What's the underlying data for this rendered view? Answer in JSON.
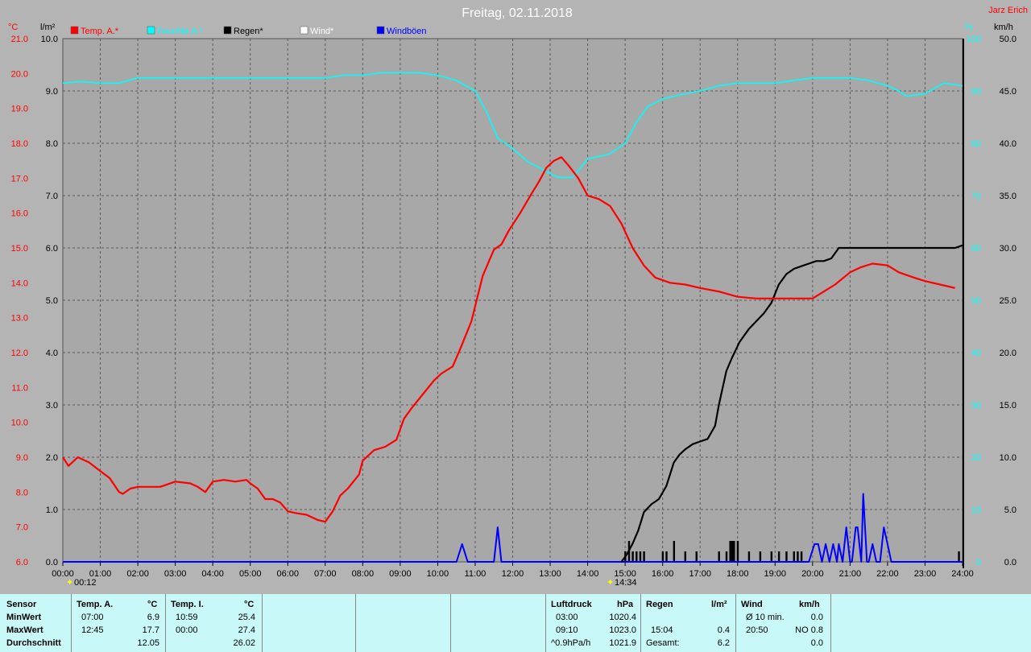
{
  "title": "Freitag, 02.11.2018",
  "author": "Jarz Erich",
  "units": {
    "temp": "°C",
    "rain": "l/m²",
    "hum": "%",
    "wind": "km/h"
  },
  "legend": [
    {
      "label": "Temp. A.*",
      "color": "#ff0000"
    },
    {
      "label": "Feuchte A.*",
      "color": "#00ffff"
    },
    {
      "label": "Regen*",
      "color": "#000000"
    },
    {
      "label": "Wind*",
      "color": "#ffffff"
    },
    {
      "label": "Windböen",
      "color": "#0000ff"
    }
  ],
  "markers": {
    "sunrise": "00:12",
    "sunset": "14:34"
  },
  "chart_data": {
    "type": "line",
    "x_unit": "hour",
    "xlim": [
      0,
      24
    ],
    "x_ticks": [
      "00:00",
      "01:00",
      "02:00",
      "03:00",
      "04:00",
      "05:00",
      "06:00",
      "07:00",
      "08:00",
      "09:00",
      "10:00",
      "11:00",
      "12:00",
      "13:00",
      "14:00",
      "15:00",
      "16:00",
      "17:00",
      "18:00",
      "19:00",
      "20:00",
      "21:00",
      "22:00",
      "23:00",
      "24:00"
    ],
    "axes": {
      "temp": {
        "label": "°C",
        "range": [
          6,
          21
        ],
        "ticks": [
          "6.0",
          "7.0",
          "8.0",
          "9.0",
          "10.0",
          "11.0",
          "12.0",
          "13.0",
          "14.0",
          "15.0",
          "16.0",
          "17.0",
          "18.0",
          "19.0",
          "20.0",
          "21.0"
        ]
      },
      "rain": {
        "label": "l/m²",
        "range": [
          0,
          10
        ],
        "ticks": [
          "0.0",
          "1.0",
          "2.0",
          "3.0",
          "4.0",
          "5.0",
          "6.0",
          "7.0",
          "8.0",
          "9.0",
          "10.0"
        ]
      },
      "hum": {
        "label": "%",
        "range": [
          0,
          100
        ],
        "ticks": [
          "0",
          "10",
          "20",
          "30",
          "40",
          "50",
          "60",
          "70",
          "80",
          "90",
          "100"
        ]
      },
      "wind": {
        "label": "km/h",
        "range": [
          0,
          50
        ],
        "ticks": [
          "0.0",
          "5.0",
          "10.0",
          "15.0",
          "20.0",
          "25.0",
          "30.0",
          "35.0",
          "40.0",
          "45.0",
          "50.0"
        ]
      }
    },
    "grid": true,
    "series": [
      {
        "name": "Temp. A.*",
        "color": "#ff0000",
        "axis": "temp",
        "x": [
          0,
          0.15,
          0.4,
          0.7,
          1,
          1.25,
          1.5,
          1.6,
          1.8,
          2,
          2.3,
          2.6,
          3,
          3.4,
          3.6,
          3.8,
          4,
          4.3,
          4.6,
          4.9,
          5,
          5.2,
          5.4,
          5.6,
          5.8,
          6,
          6.2,
          6.5,
          6.8,
          7,
          7.2,
          7.4,
          7.6,
          7.9,
          8,
          8.3,
          8.6,
          8.9,
          9.1,
          9.3,
          9.6,
          9.9,
          10.1,
          10.4,
          10.6,
          10.9,
          11.2,
          11.5,
          11.7,
          11.9,
          12.2,
          12.5,
          12.7,
          12.9,
          13.1,
          13.3,
          13.5,
          13.75,
          14,
          14.3,
          14.6,
          14.9,
          15.2,
          15.5,
          15.8,
          16.2,
          16.6,
          17,
          17.5,
          18,
          18.5,
          19,
          19.5,
          20,
          20.3,
          20.6,
          21,
          21.3,
          21.6,
          22,
          22.3,
          22.7,
          23,
          23.4,
          23.8
        ],
        "y": [
          9.0,
          8.75,
          9.0,
          8.85,
          8.6,
          8.4,
          8.0,
          7.95,
          8.1,
          8.15,
          8.15,
          8.15,
          8.3,
          8.25,
          8.15,
          8.0,
          8.3,
          8.35,
          8.3,
          8.35,
          8.25,
          8.1,
          7.8,
          7.8,
          7.7,
          7.45,
          7.4,
          7.35,
          7.2,
          7.15,
          7.45,
          7.9,
          8.1,
          8.5,
          8.9,
          9.2,
          9.3,
          9.5,
          10.1,
          10.4,
          10.8,
          11.2,
          11.4,
          11.6,
          12.1,
          12.9,
          14.2,
          14.95,
          15.1,
          15.5,
          16.0,
          16.55,
          16.9,
          17.3,
          17.5,
          17.6,
          17.35,
          17.0,
          16.5,
          16.4,
          16.2,
          15.7,
          15.0,
          14.5,
          14.15,
          14.0,
          13.95,
          13.85,
          13.75,
          13.6,
          13.55,
          13.55,
          13.55,
          13.55,
          13.75,
          13.95,
          14.3,
          14.45,
          14.55,
          14.5,
          14.3,
          14.15,
          14.05,
          13.95,
          13.85
        ]
      },
      {
        "name": "Feuchte A.*",
        "color": "#00ffff",
        "axis": "hum",
        "x": [
          0,
          0.5,
          1,
          1.5,
          2,
          3,
          4,
          5,
          6,
          7,
          7.5,
          8,
          8.5,
          9,
          9.5,
          10,
          10.5,
          11,
          11.3,
          11.6,
          12,
          12.4,
          12.8,
          13.2,
          13.6,
          14,
          14.3,
          14.6,
          15,
          15.3,
          15.6,
          16,
          16.5,
          17,
          17.5,
          18,
          18.5,
          19,
          20,
          21,
          21.5,
          22,
          22.3,
          22.5,
          23,
          23.5,
          24
        ],
        "y": [
          91.5,
          91.8,
          91.5,
          91.5,
          92.5,
          92.5,
          92.5,
          92.5,
          92.5,
          92.5,
          93,
          93,
          93.5,
          93.5,
          93.5,
          93,
          92,
          90,
          86,
          81,
          79,
          76.5,
          75,
          73.5,
          73.5,
          77,
          77.5,
          78,
          80,
          84,
          87,
          88.5,
          89.3,
          90,
          91,
          91.5,
          91.5,
          91.5,
          92.5,
          92.5,
          92,
          91,
          90,
          89,
          89.5,
          91.5,
          91
        ]
      },
      {
        "name": "Regen*",
        "color": "#000000",
        "axis": "rain",
        "x": [
          14.9,
          15.05,
          15.2,
          15.35,
          15.5,
          15.7,
          15.9,
          16.1,
          16.3,
          16.45,
          16.6,
          16.8,
          17,
          17.2,
          17.4,
          17.5,
          17.7,
          17.85,
          17.95,
          18.05,
          18.15,
          18.3,
          18.5,
          18.7,
          18.9,
          19.1,
          19.3,
          19.5,
          19.7,
          19.9,
          20.1,
          20.3,
          20.5,
          20.7,
          20.85,
          21,
          21.2,
          21.5,
          21.8,
          22.2,
          22.6,
          23,
          23.4,
          23.8,
          24
        ],
        "y": [
          0.0,
          0.15,
          0.35,
          0.6,
          0.95,
          1.1,
          1.2,
          1.45,
          1.9,
          2.05,
          2.15,
          2.25,
          2.3,
          2.35,
          2.6,
          3.0,
          3.65,
          3.9,
          4.05,
          4.2,
          4.3,
          4.45,
          4.6,
          4.75,
          4.95,
          5.3,
          5.5,
          5.6,
          5.65,
          5.7,
          5.75,
          5.75,
          5.8,
          6.0,
          6.0,
          6.0,
          6.0,
          6.0,
          6.0,
          6.0,
          6.0,
          6.0,
          6.0,
          6.0,
          6.05
        ]
      },
      {
        "name": "Windböen",
        "color": "#0000ff",
        "axis": "wind",
        "x": [
          0,
          10.5,
          10.65,
          10.8,
          11.3,
          11.5,
          11.6,
          11.7,
          12.5,
          19.9,
          20.05,
          20.15,
          20.25,
          20.35,
          20.45,
          20.55,
          20.65,
          20.7,
          20.8,
          20.9,
          21,
          21.05,
          21.15,
          21.2,
          21.3,
          21.35,
          21.45,
          21.5,
          21.6,
          21.7,
          21.8,
          21.9,
          22,
          22.1,
          22.2,
          22.5,
          24
        ],
        "y": [
          0,
          0,
          1.7,
          0,
          0,
          0,
          3.3,
          0,
          0,
          0,
          1.7,
          1.7,
          0,
          1.7,
          0,
          1.7,
          0,
          1.7,
          0,
          3.3,
          0,
          0,
          3.3,
          3.3,
          0,
          6.5,
          0,
          0,
          1.7,
          0,
          0,
          3.3,
          1.7,
          0,
          0,
          0,
          0
        ]
      }
    ],
    "rain_bars": {
      "name": "Regen (Intervall)",
      "color": "#000000",
      "axis": "rain",
      "x": [
        15.0,
        15.1,
        15.2,
        15.3,
        15.4,
        15.5,
        16.0,
        16.1,
        16.3,
        16.6,
        16.9,
        17.5,
        17.7,
        17.8,
        17.85,
        17.9,
        18.0,
        18.3,
        18.6,
        18.9,
        19.1,
        19.3,
        19.5,
        19.6,
        19.7,
        23.9
      ],
      "y": [
        0.2,
        0.4,
        0.2,
        0.2,
        0.2,
        0.2,
        0.2,
        0.2,
        0.4,
        0.2,
        0.2,
        0.2,
        0.2,
        0.4,
        0.4,
        0.4,
        0.4,
        0.2,
        0.2,
        0.2,
        0.2,
        0.2,
        0.2,
        0.2,
        0.2,
        0.2
      ]
    }
  },
  "table": {
    "row_labels": [
      "Sensor",
      "MinWert",
      "MaxWert",
      "Durchschnitt"
    ],
    "temp_a": {
      "header": "Temp. A.",
      "unit": "°C",
      "min_time": "07:00",
      "min_val": "6.9",
      "max_time": "12:45",
      "max_val": "17.7",
      "avg": "12.05"
    },
    "temp_i": {
      "header": "Temp. I.",
      "unit": "°C",
      "min_time": "10:59",
      "min_val": "25.4",
      "max_time": "00:00",
      "max_val": "27.4",
      "avg": "26.02"
    },
    "pressure": {
      "header": "Luftdruck",
      "unit": "hPa",
      "r1_time": "03:00",
      "r1_val": "1020.4",
      "r2_time": "09:10",
      "r2_val": "1023.0",
      "r3_label": "^0.9hPa/h",
      "r3_val": "1021.9"
    },
    "rain": {
      "header": "Regen",
      "unit": "l/m²",
      "r2_time": "15:04",
      "r2_val": "0.4",
      "r3_label": "Gesamt:",
      "r3_val": "6.2"
    },
    "wind": {
      "header": "Wind",
      "unit": "km/h",
      "r1_label": "Ø 10 min.",
      "r1_val": "0.0",
      "r2_time": "20:50",
      "r2_val": "NO 0.8",
      "r3_val": "0.0"
    }
  }
}
